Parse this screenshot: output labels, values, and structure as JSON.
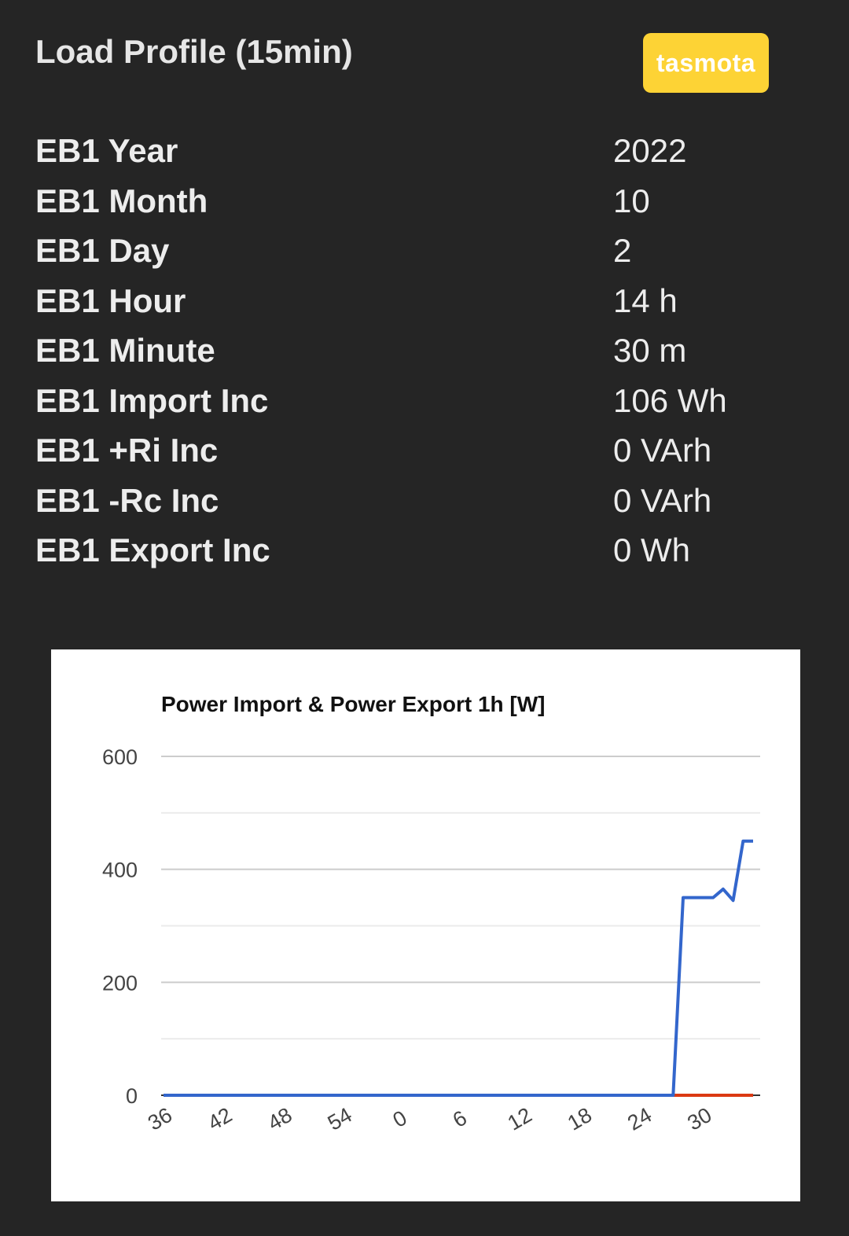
{
  "header": {
    "title": "Load Profile (15min)",
    "brand": "tasmota",
    "brand_color": "#fdd335"
  },
  "readings": [
    {
      "label": "EB1 Year",
      "value": "2022"
    },
    {
      "label": "EB1 Month",
      "value": "10"
    },
    {
      "label": "EB1 Day",
      "value": "2"
    },
    {
      "label": "EB1 Hour",
      "value": "14 h"
    },
    {
      "label": "EB1 Minute",
      "value": "30 m"
    },
    {
      "label": "EB1 Import Inc",
      "value": "106 Wh"
    },
    {
      "label": "EB1 +Ri Inc",
      "value": "0 VArh"
    },
    {
      "label": "EB1 -Rc Inc",
      "value": "0 VArh"
    },
    {
      "label": "EB1 Export Inc",
      "value": "0 Wh"
    }
  ],
  "chart_data": {
    "type": "line",
    "title": "Power Import & Power Export 1h [W]",
    "xlabel": "",
    "ylabel": "",
    "ylim": [
      0,
      600
    ],
    "yticks": [
      "600",
      "400",
      "200",
      "0"
    ],
    "ytick_values": [
      600,
      400,
      200,
      0
    ],
    "minor_grid_values": [
      500,
      300,
      100
    ],
    "grid": true,
    "x_tick_labels": [
      "36",
      "42",
      "48",
      "54",
      "0",
      "6",
      "12",
      "18",
      "24",
      "30"
    ],
    "x_tick_index": [
      0,
      6,
      12,
      18,
      24,
      30,
      36,
      42,
      48,
      54
    ],
    "x_count": 60,
    "series": [
      {
        "color": "#3366cc",
        "values": [
          0,
          0,
          0,
          0,
          0,
          0,
          0,
          0,
          0,
          0,
          0,
          0,
          0,
          0,
          0,
          0,
          0,
          0,
          0,
          0,
          0,
          0,
          0,
          0,
          0,
          0,
          0,
          0,
          0,
          0,
          0,
          0,
          0,
          0,
          0,
          0,
          0,
          0,
          0,
          0,
          0,
          0,
          0,
          0,
          0,
          0,
          0,
          0,
          0,
          0,
          0,
          0,
          350,
          350,
          350,
          350,
          365,
          345,
          450,
          450
        ]
      },
      {
        "color": "#dc3912",
        "values": [
          0,
          0,
          0,
          0,
          0,
          0,
          0,
          0,
          0,
          0,
          0,
          0,
          0,
          0,
          0,
          0,
          0,
          0,
          0,
          0,
          0,
          0,
          0,
          0,
          0,
          0,
          0,
          0,
          0,
          0,
          0,
          0,
          0,
          0,
          0,
          0,
          0,
          0,
          0,
          0,
          0,
          0,
          0,
          0,
          0,
          0,
          0,
          0,
          0,
          0,
          0,
          0,
          0,
          0,
          0,
          0,
          0,
          0,
          0,
          0
        ]
      }
    ]
  }
}
